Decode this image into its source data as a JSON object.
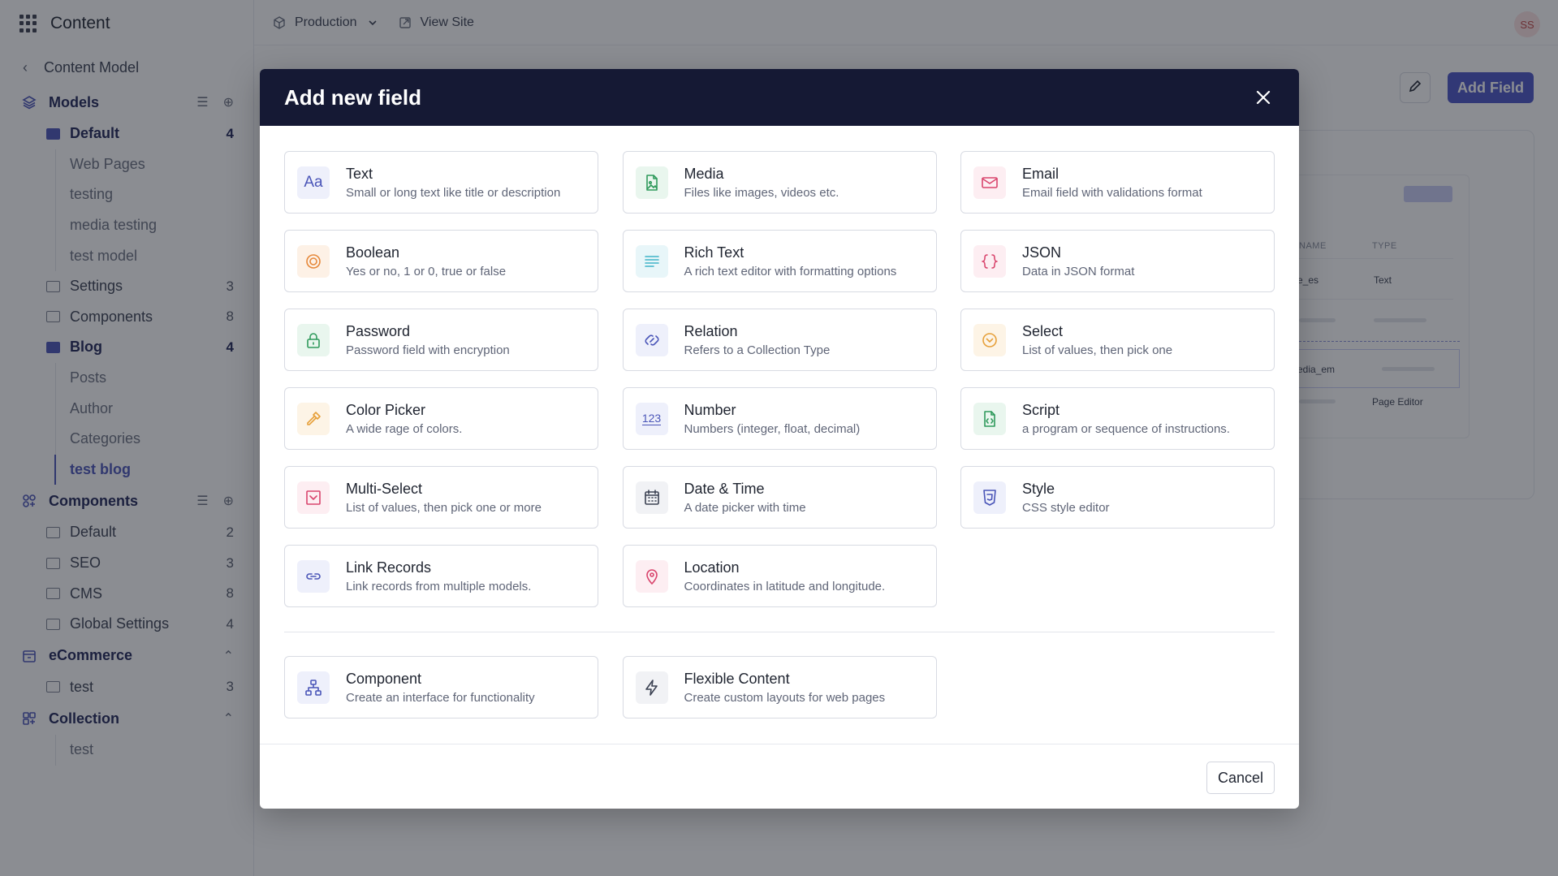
{
  "app": {
    "title": "Content"
  },
  "sidebar": {
    "back_label": "Content Model",
    "models": {
      "label": "Models",
      "folders": [
        {
          "name": "Default",
          "count": "4",
          "open": true,
          "children": [
            "Web Pages",
            "testing",
            "media testing",
            "test model"
          ]
        },
        {
          "name": "Settings",
          "count": "3",
          "open": false
        },
        {
          "name": "Components",
          "count": "8",
          "open": false
        },
        {
          "name": "Blog",
          "count": "4",
          "open": true,
          "children": [
            "Posts",
            "Author",
            "Categories",
            "test blog"
          ],
          "active_child": "test blog"
        }
      ]
    },
    "components": {
      "label": "Components",
      "folders": [
        {
          "name": "Default",
          "count": "2"
        },
        {
          "name": "SEO",
          "count": "3"
        },
        {
          "name": "CMS",
          "count": "8"
        },
        {
          "name": "Global Settings",
          "count": "4"
        }
      ]
    },
    "ecommerce": {
      "label": "eCommerce",
      "folders": [
        {
          "name": "test",
          "count": "3"
        }
      ]
    },
    "collection": {
      "label": "Collection",
      "children": [
        "test"
      ]
    }
  },
  "topbar": {
    "environment": "Production",
    "view_site": "View Site",
    "avatar_initials": "SS"
  },
  "background": {
    "add_field_label": "Add Field",
    "table_headers": [
      "NAME",
      "TYPE"
    ],
    "row1_name": "e_es",
    "row1_type": "Text",
    "row2_name": "edia_em",
    "row3_type": "Page Editor"
  },
  "modal": {
    "title": "Add new field",
    "fields": [
      {
        "name": "Text",
        "desc": "Small or long text like title or description",
        "icon": "text-aa-icon",
        "color": "#4a55b8",
        "bg": "#eef0fb"
      },
      {
        "name": "Media",
        "desc": "Files like images, videos etc.",
        "icon": "image-file-icon",
        "color": "#2f9a5c",
        "bg": "#e9f6ee"
      },
      {
        "name": "Email",
        "desc": "Email field with validations format",
        "icon": "envelope-icon",
        "color": "#d9456d",
        "bg": "#fdeef2"
      },
      {
        "name": "Boolean",
        "desc": "Yes or no, 1 or 0, true or false",
        "icon": "toggle-circle-icon",
        "color": "#e6883a",
        "bg": "#fdf1e6"
      },
      {
        "name": "Rich Text",
        "desc": "A rich text editor with formatting options",
        "icon": "paragraph-lines-icon",
        "color": "#3fb3c8",
        "bg": "#e8f6f9"
      },
      {
        "name": "JSON",
        "desc": "Data in JSON format",
        "icon": "curly-braces-icon",
        "color": "#d9456d",
        "bg": "#fdeef2"
      },
      {
        "name": "Password",
        "desc": "Password field with encryption",
        "icon": "lock-icon",
        "color": "#2f9a5c",
        "bg": "#e9f6ee"
      },
      {
        "name": "Relation",
        "desc": "Refers to a Collection Type",
        "icon": "relation-link-icon",
        "color": "#4a55b8",
        "bg": "#eef0fb"
      },
      {
        "name": "Select",
        "desc": "List of values, then pick one",
        "icon": "chevron-circle-icon",
        "color": "#e6a03a",
        "bg": "#fdf4e6"
      },
      {
        "name": "Color Picker",
        "desc": "A wide rage of colors.",
        "icon": "eyedropper-icon",
        "color": "#e6a03a",
        "bg": "#fdf4e6"
      },
      {
        "name": "Number",
        "desc": "Numbers (integer, float, decimal)",
        "icon": "number-123-icon",
        "color": "#4a55b8",
        "bg": "#eef0fb",
        "glyph": "123"
      },
      {
        "name": "Script",
        "desc": "a program or sequence of instructions.",
        "icon": "code-file-icon",
        "color": "#2f9a5c",
        "bg": "#e9f6ee"
      },
      {
        "name": "Multi-Select",
        "desc": "List of values, then pick one or more",
        "icon": "multi-select-icon",
        "color": "#d9456d",
        "bg": "#fdeef2"
      },
      {
        "name": "Date & Time",
        "desc": "A date picker with time",
        "icon": "calendar-icon",
        "color": "#3b4152",
        "bg": "#f1f2f5"
      },
      {
        "name": "Style",
        "desc": "CSS style editor",
        "icon": "css-shield-icon",
        "color": "#4a55b8",
        "bg": "#eef0fb"
      },
      {
        "name": "Link Records",
        "desc": "Link records from multiple models.",
        "icon": "chain-link-icon",
        "color": "#4a55b8",
        "bg": "#eef0fb"
      },
      {
        "name": "Location",
        "desc": "Coordinates in latitude and longitude.",
        "icon": "map-pin-icon",
        "color": "#d9456d",
        "bg": "#fdeef2"
      }
    ],
    "components": [
      {
        "name": "Component",
        "desc": "Create an interface for functionality",
        "icon": "component-tree-icon",
        "color": "#4a55b8",
        "bg": "#eef0fb"
      },
      {
        "name": "Flexible Content",
        "desc": "Create custom layouts for web pages",
        "icon": "lightning-icon",
        "color": "#3b4152",
        "bg": "#f1f2f5"
      }
    ],
    "cancel_label": "Cancel"
  }
}
